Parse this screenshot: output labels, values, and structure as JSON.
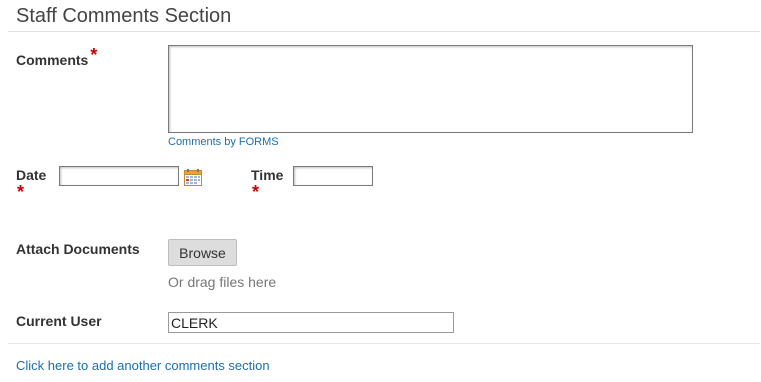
{
  "section": {
    "title": "Staff Comments Section"
  },
  "comments": {
    "label": "Comments",
    "required_mark": "*",
    "value": "",
    "sublink": "Comments by FORMS"
  },
  "date": {
    "label": "Date",
    "required_mark": "*",
    "value": "",
    "icon": "calendar-icon"
  },
  "time": {
    "label": "Time",
    "required_mark": "*",
    "value": ""
  },
  "attach": {
    "label": "Attach Documents",
    "browse_label": "Browse",
    "drag_text": "Or drag files here"
  },
  "current_user": {
    "label": "Current User",
    "value": "CLERK"
  },
  "footer": {
    "add_link": "Click here to add another comments section"
  },
  "colors": {
    "link": "#1a6fb0",
    "required": "#cc0000",
    "button_bg": "#dddddd"
  }
}
